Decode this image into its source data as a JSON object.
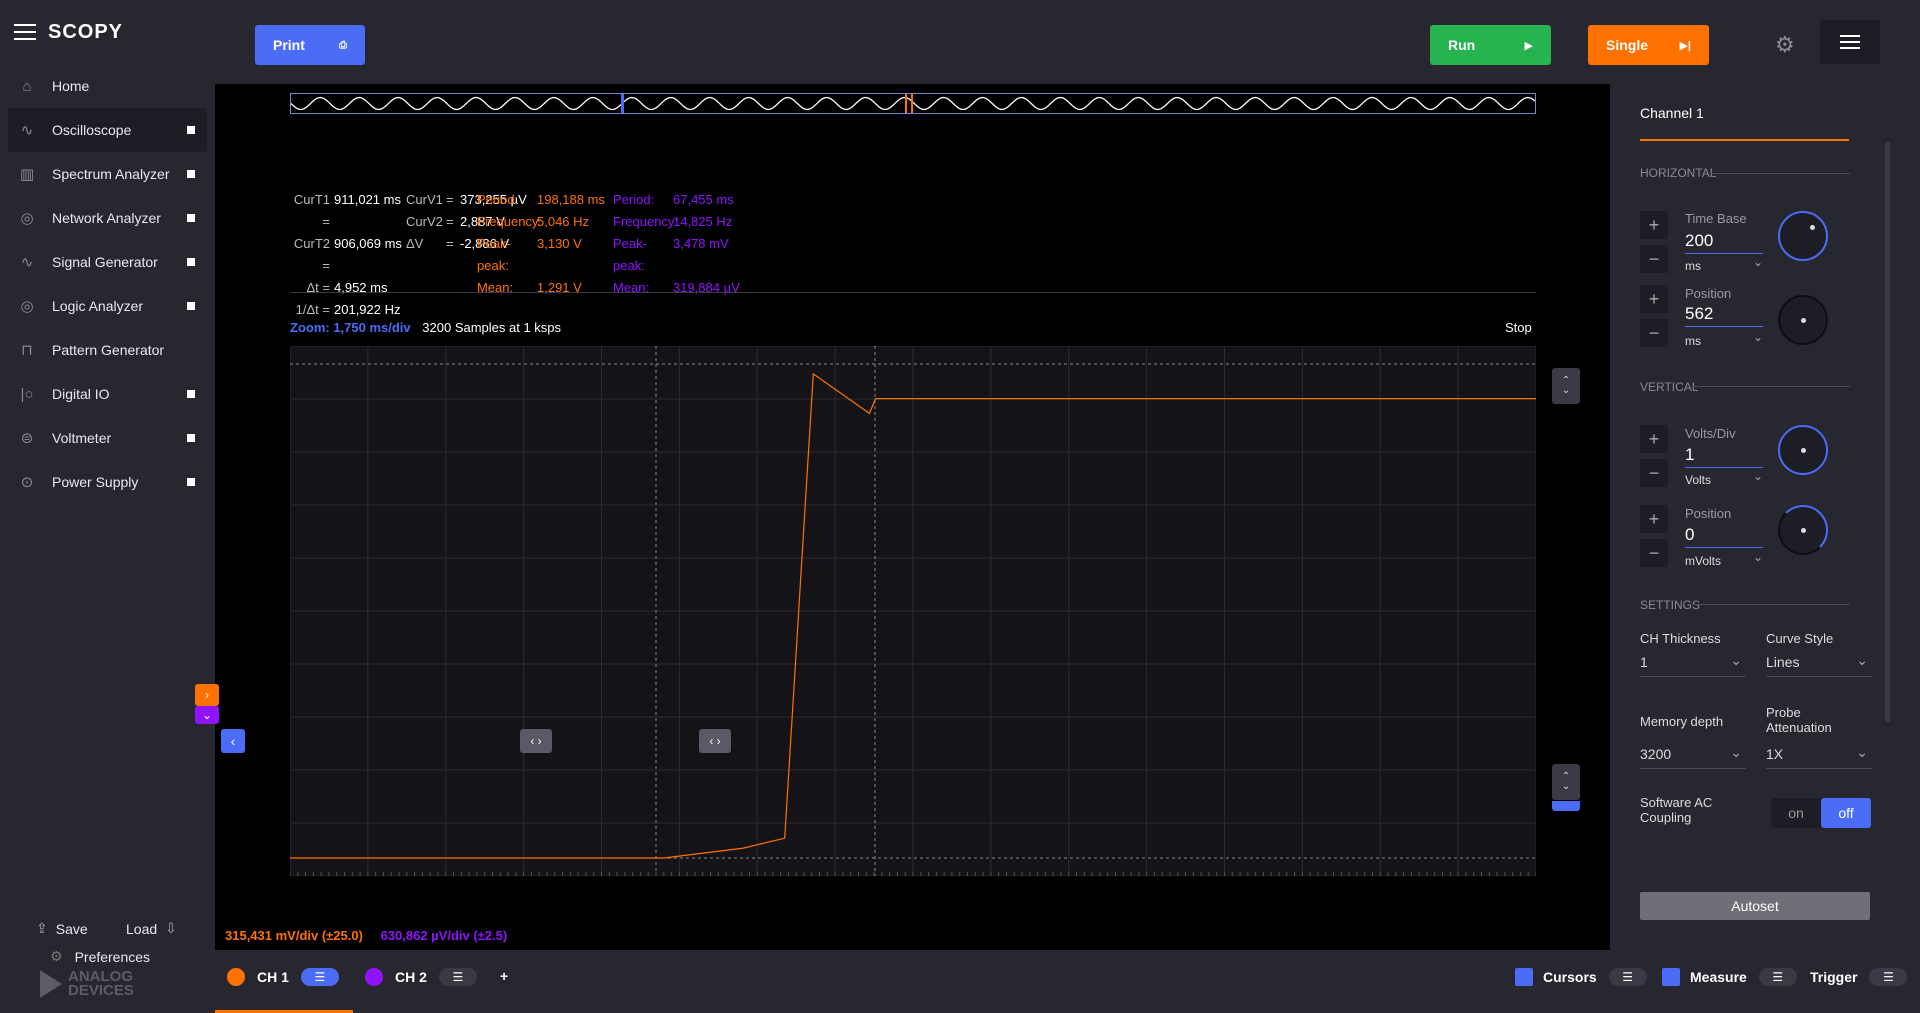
{
  "app": {
    "logo": "SCOPY"
  },
  "sidebar": {
    "items": [
      {
        "label": "Home",
        "icon": "home-icon",
        "glyph": "⌂",
        "dot": false,
        "active": false
      },
      {
        "label": "Oscilloscope",
        "icon": "oscilloscope-icon",
        "glyph": "∿",
        "dot": true,
        "active": true
      },
      {
        "label": "Spectrum Analyzer",
        "icon": "spectrum-icon",
        "glyph": "▥",
        "dot": true,
        "active": false
      },
      {
        "label": "Network Analyzer",
        "icon": "network-icon",
        "glyph": "◎",
        "dot": true,
        "active": false
      },
      {
        "label": "Signal Generator",
        "icon": "signal-icon",
        "glyph": "∿",
        "dot": true,
        "active": false
      },
      {
        "label": "Logic Analyzer",
        "icon": "logic-icon",
        "glyph": "◎",
        "dot": true,
        "active": false
      },
      {
        "label": "Pattern Generator",
        "icon": "pattern-icon",
        "glyph": "⊓",
        "dot": false,
        "active": false
      },
      {
        "label": "Digital IO",
        "icon": "digital-icon",
        "glyph": "|○",
        "dot": true,
        "active": false
      },
      {
        "label": "Voltmeter",
        "icon": "voltmeter-icon",
        "glyph": "⊜",
        "dot": true,
        "active": false
      },
      {
        "label": "Power Supply",
        "icon": "power-icon",
        "glyph": "⊙",
        "dot": true,
        "active": false
      }
    ],
    "save": "Save",
    "load": "Load",
    "preferences": "Preferences",
    "brand": [
      "ANALOG",
      "DEVICES"
    ]
  },
  "toolbar": {
    "print": "Print",
    "run": "Run",
    "single": "Single"
  },
  "cursors": {
    "t": [
      [
        "CurT1 =",
        "911,021 ms"
      ],
      [
        "CurT2 =",
        "906,069 ms"
      ],
      [
        "Δt =",
        "4,952 ms"
      ],
      [
        "1/Δt =",
        "201,922 Hz"
      ]
    ],
    "v": [
      [
        "CurV1",
        "=",
        "373,255 µV"
      ],
      [
        "CurV2",
        "=",
        "2,887 V"
      ],
      [
        "ΔV",
        "=",
        "-2,886 V"
      ]
    ]
  },
  "measure": {
    "ch1": [
      [
        "Period:",
        "198,188 ms"
      ],
      [
        "Frequency:",
        "5,046 Hz"
      ],
      [
        "Peak-peak:",
        "3,130 V"
      ],
      [
        "Mean:",
        "1,291 V"
      ]
    ],
    "ch2": [
      [
        "Period:",
        "67,455 ms"
      ],
      [
        "Frequency:",
        "14,825 Hz"
      ],
      [
        "Peak-peak:",
        "3,478 mV"
      ],
      [
        "Mean:",
        "319,884 µV"
      ]
    ]
  },
  "plot": {
    "zoom": "Zoom: 1,750 ms/div",
    "samples": "3200 Samples at 1 ksps",
    "status": "Stop",
    "ch1_scale": "315,431 mV/div (±25.0)",
    "ch2_scale": "630,862 µV/div (±2.5)"
  },
  "colors": {
    "ch1": "#ff7200",
    "ch2": "#9013fe",
    "accent": "#4a6cf7",
    "run": "#27b34f",
    "single": "#ff7200"
  },
  "panel": {
    "title": "Channel 1",
    "horizontal": "HORIZONTAL",
    "time_base_label": "Time Base",
    "time_base": "200",
    "time_base_unit": "ms",
    "h_position_label": "Position",
    "h_position": "562",
    "h_position_unit": "ms",
    "vertical": "VERTICAL",
    "volts_label": "Volts/Div",
    "volts": "1",
    "volts_unit": "Volts",
    "v_position_label": "Position",
    "v_position": "0",
    "v_position_unit": "mVolts",
    "settings": "SETTINGS",
    "thickness_label": "CH Thickness",
    "thickness": "1",
    "curve_label": "Curve Style",
    "curve": "Lines",
    "memory_label": "Memory depth",
    "memory": "3200",
    "probe_label": "Probe Attenuation",
    "probe": "1X",
    "ac_label": "Software AC Coupling",
    "on": "on",
    "off": "off",
    "autoset": "Autoset"
  },
  "bottom": {
    "ch1": "CH 1",
    "ch2": "CH 2",
    "add": "+",
    "cursors": "Cursors",
    "measure": "Measure",
    "trigger": "Trigger"
  },
  "chart_data": {
    "type": "line",
    "series": [
      {
        "name": "CH 1",
        "x": [
          0,
          0.3,
          0.364,
          0.397,
          0.42,
          0.465,
          0.47,
          1
        ],
        "y": [
          0,
          0,
          0.02,
          0.04,
          0.98,
          0.9,
          0.93,
          0.93
        ]
      }
    ],
    "xlim": [
      0,
      1
    ],
    "ylim": [
      0,
      1
    ]
  }
}
